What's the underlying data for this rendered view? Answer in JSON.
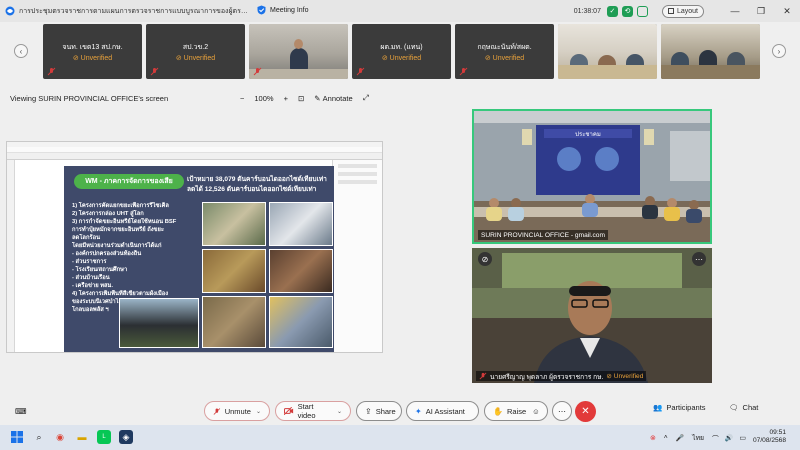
{
  "window": {
    "title": "การประชุมตรวจราชการตามแผนการตรวจราชการแบบบูรณาการของผู้ตรวจราชการ ประจำปี...",
    "meeting_info": "Meeting Info",
    "timer": "01:38:07",
    "layout_label": "Layout"
  },
  "thumbnails": [
    {
      "name": "จนท. เขต13 สป.กษ.",
      "status": "Unverified"
    },
    {
      "name": "สป.วข.2",
      "status": "Unverified"
    },
    {
      "name": "",
      "status": ""
    },
    {
      "name": "ผต.มท. (แทน)",
      "status": "Unverified"
    },
    {
      "name": "กฤษณะนันท์/สผต.",
      "status": "Unverified"
    },
    {
      "name": "",
      "status": ""
    },
    {
      "name": "",
      "status": ""
    }
  ],
  "viewbar": {
    "viewing": "Viewing SURIN PROVINCIAL OFFICE's screen",
    "zoom": "100%",
    "minus": "−",
    "plus": "+",
    "annotate": "Annotate"
  },
  "slide": {
    "banner": "WM - ภาคการจัดการของเสีย",
    "target_line1": "เป้าหมาย 38,079 ตันคาร์บอนไดออกไซด์เทียบเท่า",
    "target_line2": "ลดได้ 12,526 ตันคาร์บอนไดออกไซด์เทียบเท่า",
    "bullets": [
      "1)   โครงการคัดแยกขยะเพื่อการรีไซเคิล",
      "2)   โครงการกล่อง UHT สู่โลก",
      "3)   การกำจัดขยะอินทรีย์โดยใช้หนอน BSF",
      "      การทำปุ๋ยหมักจากขยะอินทรีย์ ถังขยะ",
      "      ลดโลกร้อน",
      "โดยมีหน่วยงานร่วมดำเนินการได้แก่",
      "      - องค์กรปกครองส่วนท้องถิ่น",
      "      - ส่วนราชการ",
      "      - โรงเรียน/สถานศึกษา",
      "      - ส่วนบ้านเรือน",
      "      - เครือข่าย ทสม.",
      "4) โครงการเพิ่มพื้นที่สีเขียวตามผังเมือง",
      "ของระบบนิเวศป่าไม้ ป่าชุมชน จ.สุรินทร์",
      "โกลบอลพลัส ฯ"
    ]
  },
  "panels": {
    "top": {
      "caption": "SURIN PROVINCIAL OFFICE - gmail.com"
    },
    "bottom": {
      "caption": "นายศรีญาญ พุดลาภ  ผู้ตรวจราชการ กษ.",
      "status": "Unverified"
    }
  },
  "controls": {
    "unmute": "Unmute",
    "start_video": "Start video",
    "share": "Share",
    "ai_assistant": "AI Assistant",
    "raise": "Raise",
    "participants": "Participants",
    "chat": "Chat"
  },
  "taskbar": {
    "lang": "ไทย",
    "time": "09:51",
    "date": "07/08/2568"
  },
  "colors": {
    "accent_green": "#37c87c",
    "unverified": "#e9a23b",
    "leave_red": "#e23a3a",
    "mute_red": "#d23b3b"
  }
}
